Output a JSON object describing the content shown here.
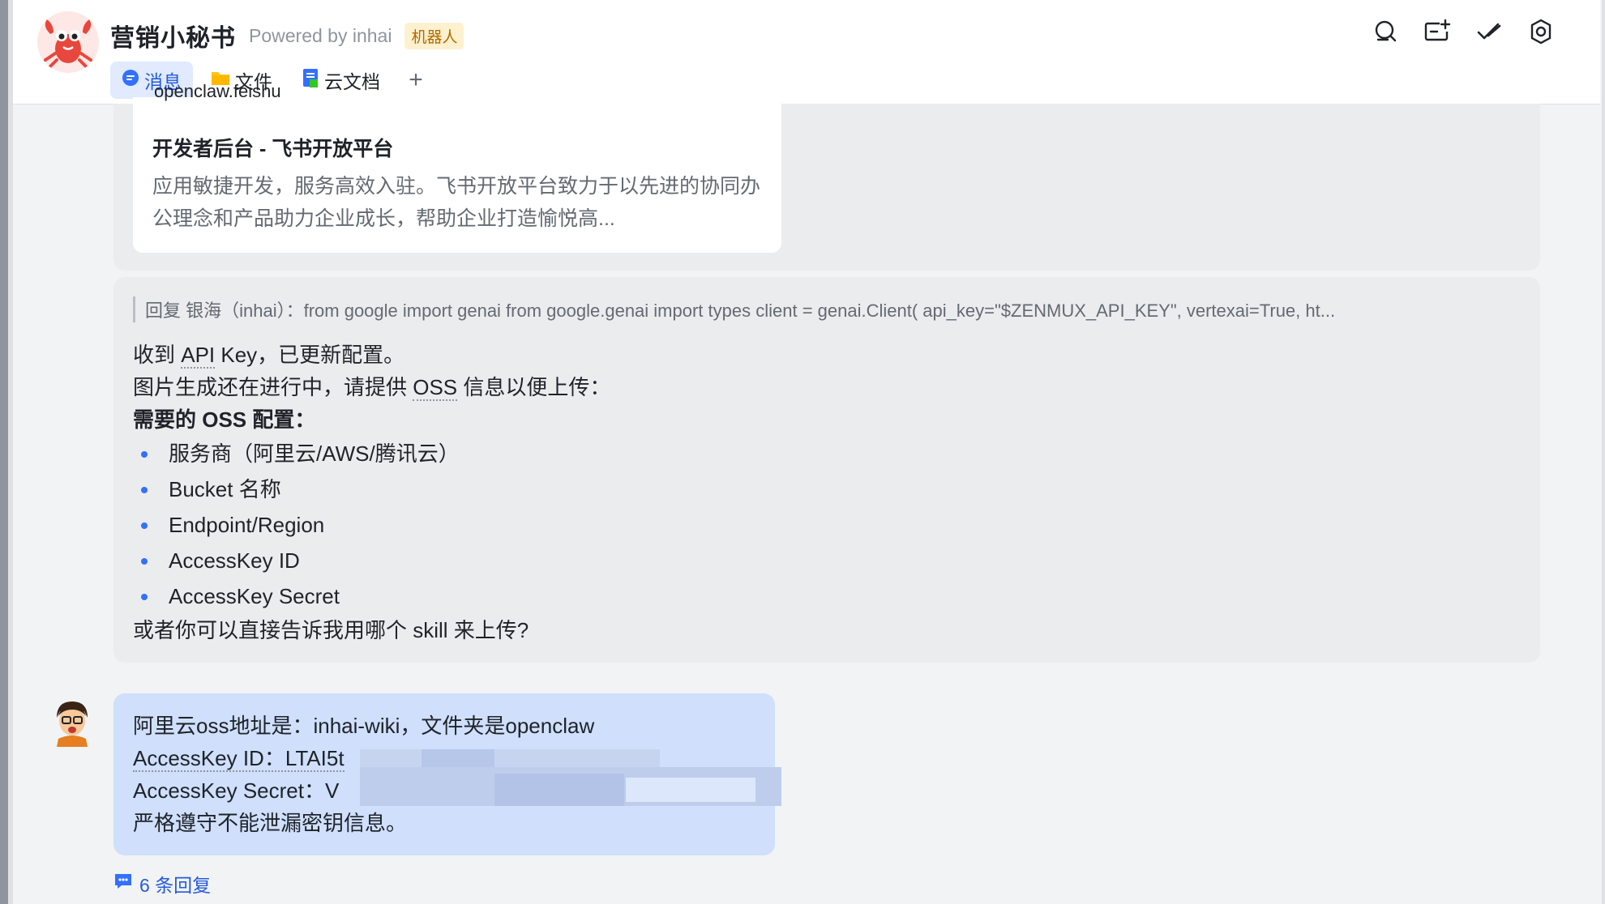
{
  "header": {
    "title": "营销小秘书",
    "powered_by": "Powered by inhai",
    "badge": "机器人",
    "tabs": [
      {
        "label": "消息",
        "icon": "message-icon",
        "active": true
      },
      {
        "label": "文件",
        "icon": "folder-icon",
        "active": false
      },
      {
        "label": "云文档",
        "icon": "doc-icon",
        "active": false
      }
    ],
    "add_tab": "+",
    "actions": [
      "search-icon",
      "add-widget-icon",
      "check-done-icon",
      "settings-icon"
    ]
  },
  "link_card": {
    "partial_text": "openclaw.feishu",
    "title": "开发者后台 - 飞书开放平台",
    "description": "应用敏捷开发，服务高效入驻。飞书开放平台致力于以先进的协同办公理念和产品助力企业成长，帮助企业打造愉悦高..."
  },
  "bot_message": {
    "quote": "回复 银海（inhai）：from google import genai from google.genai import types client = genai.Client( api_key=\"$ZENMUX_API_KEY\", vertexai=True, ht...",
    "line1_a": "收到 ",
    "line1_b": "API",
    "line1_c": " Key，已更新配置。",
    "line2_a": "图片生成还在进行中，请提供 ",
    "line2_b": "OSS",
    "line2_c": " 信息以便上传：",
    "heading": "需要的 OSS 配置：",
    "items": [
      "服务商（阿里云/AWS/腾讯云）",
      "Bucket 名称",
      "Endpoint/Region",
      "AccessKey ID",
      "AccessKey Secret"
    ],
    "closing": "或者你可以直接告诉我用哪个 skill 来上传?"
  },
  "user_message": {
    "line1": "阿里云oss地址是：inhai-wiki，文件夹是openclaw",
    "line2": "AccessKey ID：LTAI5t",
    "line3": "AccessKey Secret：V",
    "line4": "严格遵守不能泄漏密钥信息。"
  },
  "thread": {
    "replies": "6 条回复"
  },
  "colors": {
    "accent": "#245bdb",
    "user_bubble": "#cfdffc",
    "bot_bubble": "#ebecee",
    "badge_bg": "#fdf1cf"
  }
}
